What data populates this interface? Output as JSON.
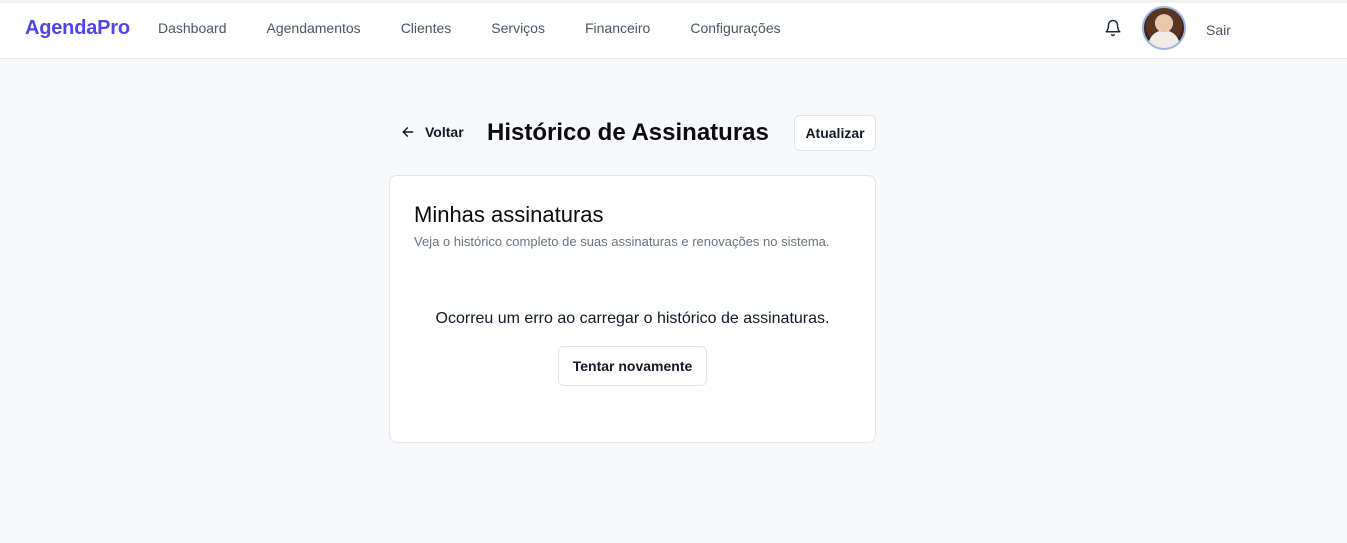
{
  "brand": "AgendaPro",
  "nav": [
    "Dashboard",
    "Agendamentos",
    "Clientes",
    "Serviços",
    "Financeiro",
    "Configurações"
  ],
  "user": {
    "logout_label": "Sair",
    "notification_icon": "bell-icon",
    "avatar": "user-avatar"
  },
  "header": {
    "back_label": "Voltar",
    "title": "Histórico de Assinaturas",
    "refresh_label": "Atualizar"
  },
  "card": {
    "title": "Minhas assinaturas",
    "description": "Veja o histórico completo de suas assinaturas e renovações no sistema.",
    "error_message": "Ocorreu um erro ao carregar o histórico de assinaturas.",
    "retry_label": "Tentar novamente"
  },
  "colors": {
    "brand": "#5046e5",
    "background": "#f8f9fb"
  }
}
